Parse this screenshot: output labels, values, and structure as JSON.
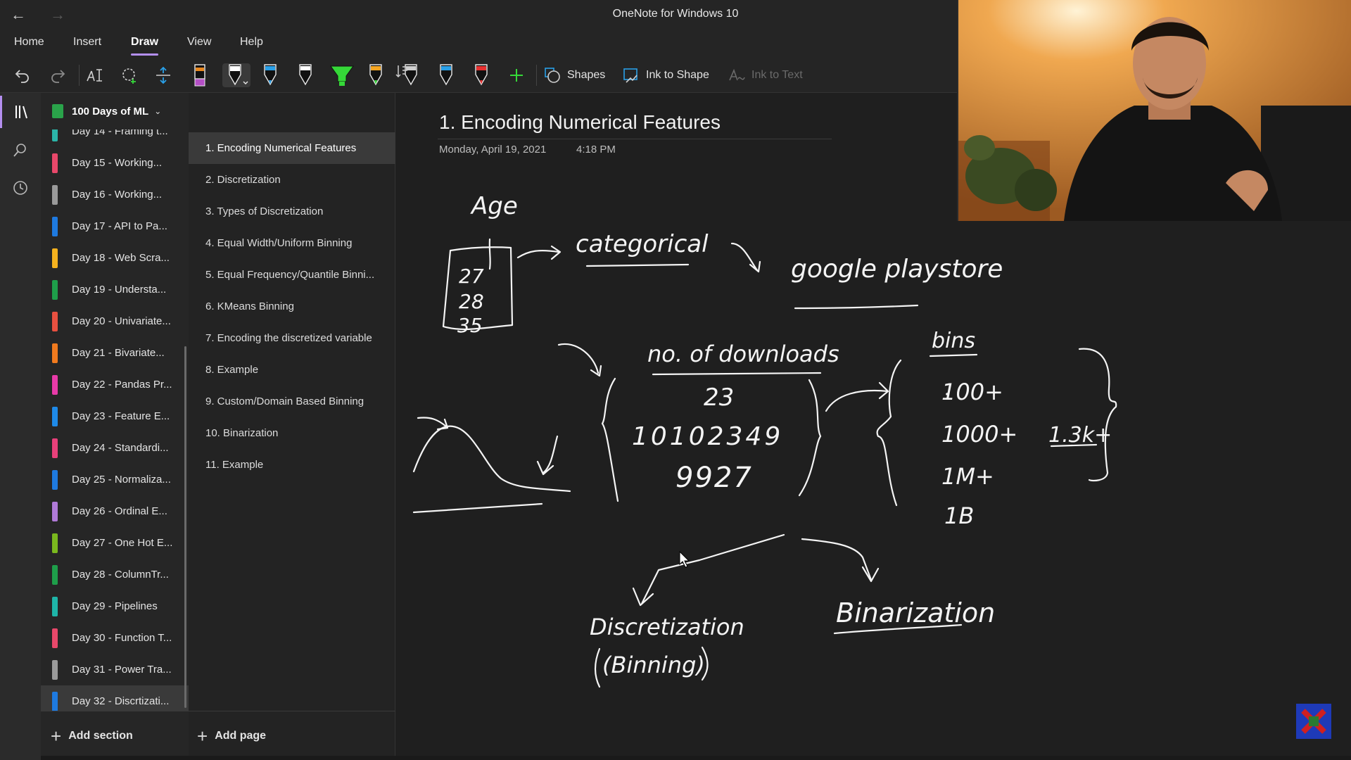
{
  "window": {
    "title": "OneNote for Windows 10"
  },
  "menu": {
    "items": [
      "Home",
      "Insert",
      "Draw",
      "View",
      "Help"
    ],
    "active": "Draw"
  },
  "toolbar": {
    "shapes_label": "Shapes",
    "ink_to_shape_label": "Ink to Shape",
    "ink_to_text_label": "Ink to Text",
    "pen_colors": [
      "#e8871e",
      "#ffffff",
      "#2aa0e8",
      "#ffffff",
      "#35d838",
      "#f5a623",
      "#ffffff",
      "#2aa0e8",
      "#e83030"
    ]
  },
  "notebook": {
    "name": "100 Days of ML"
  },
  "sections": [
    {
      "label": "Day 14 - Framing t...",
      "color": "#2bb5a8"
    },
    {
      "label": "Day 15 - Working...",
      "color": "#e8486a"
    },
    {
      "label": "Day 16 - Working...",
      "color": "#9a9a9a"
    },
    {
      "label": "Day 17 - API to Pa...",
      "color": "#1e7ae0"
    },
    {
      "label": "Day 18 - Web Scra...",
      "color": "#f5b21e"
    },
    {
      "label": "Day 19 - Understa...",
      "color": "#1e9e4a"
    },
    {
      "label": "Day 20 - Univariate...",
      "color": "#e85040"
    },
    {
      "label": "Day 21 - Bivariate...",
      "color": "#f07a1e"
    },
    {
      "label": "Day 22 - Pandas Pr...",
      "color": "#e83aa8"
    },
    {
      "label": "Day 23 - Feature E...",
      "color": "#1e8ae8"
    },
    {
      "label": "Day 24 - Standardi...",
      "color": "#e8407a"
    },
    {
      "label": "Day 25 - Normaliza...",
      "color": "#1e7ae0"
    },
    {
      "label": "Day 26 - Ordinal E...",
      "color": "#b07ad8"
    },
    {
      "label": "Day 27 - One Hot E...",
      "color": "#7ab81e"
    },
    {
      "label": "Day 28 - ColumnTr...",
      "color": "#1e9e4a"
    },
    {
      "label": "Day 29 - Pipelines",
      "color": "#1eb5a8"
    },
    {
      "label": "Day 30 - Function T...",
      "color": "#e8486a"
    },
    {
      "label": "Day 31 - Power Tra...",
      "color": "#9a9a9a"
    },
    {
      "label": "Day 32 - Discrtizati...",
      "color": "#1e7ae0"
    }
  ],
  "selected_section_index": 18,
  "add_section_label": "Add section",
  "pages": [
    "1. Encoding Numerical Features",
    "2. Discretization",
    "3. Types of Discretization",
    "4. Equal Width/Uniform Binning",
    "5. Equal Frequency/Quantile Binni...",
    "6. KMeans Binning",
    "7. Encoding the discretized variable",
    "8. Example",
    "9. Custom/Domain Based Binning",
    "10. Binarization",
    "11. Example"
  ],
  "selected_page_index": 0,
  "add_page_label": "Add page",
  "page": {
    "title": "1. Encoding Numerical Features",
    "date": "Monday, April 19, 2021",
    "time": "4:18 PM"
  },
  "ink": {
    "age": "Age",
    "age_values": [
      "27",
      "28",
      "35"
    ],
    "categorical": "categorical",
    "playstore": "google playstore",
    "downloads": "no. of downloads",
    "download_values": [
      "23",
      "10102349",
      "9927"
    ],
    "bins": "bins",
    "bin_values": [
      "100+",
      "1000+",
      "1M+",
      "1B"
    ],
    "bin_extra": "1.3k+",
    "discretization": "Discretization",
    "binning": "(Binning)",
    "binarization": "Binarization"
  }
}
